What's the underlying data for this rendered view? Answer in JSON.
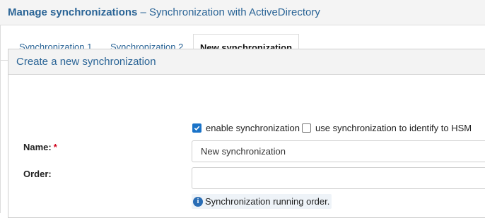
{
  "header": {
    "title_strong": "Manage synchronizations",
    "title_rest": " – Synchronization with ActiveDirectory"
  },
  "tabs": [
    {
      "label": "Synchronization 1",
      "active": false
    },
    {
      "label": "Synchronization 2",
      "active": false
    },
    {
      "label": "New synchronization",
      "active": true
    }
  ],
  "panel": {
    "title": "Create a new synchronization",
    "enable_sync": {
      "label": "enable synchronization",
      "checked": true
    },
    "use_hsm": {
      "label": "use synchronization to identify to HSM",
      "checked": false
    },
    "name": {
      "label": "Name:",
      "required_mark": "*",
      "value": "New synchronization"
    },
    "order": {
      "label": "Order:",
      "value": ""
    },
    "order_help": "Synchronization running order.",
    "info_icon": "info-icon"
  },
  "colors": {
    "accent": "#2a6496",
    "checkbox_checked": "#1a73c8",
    "required": "#d0021b"
  }
}
